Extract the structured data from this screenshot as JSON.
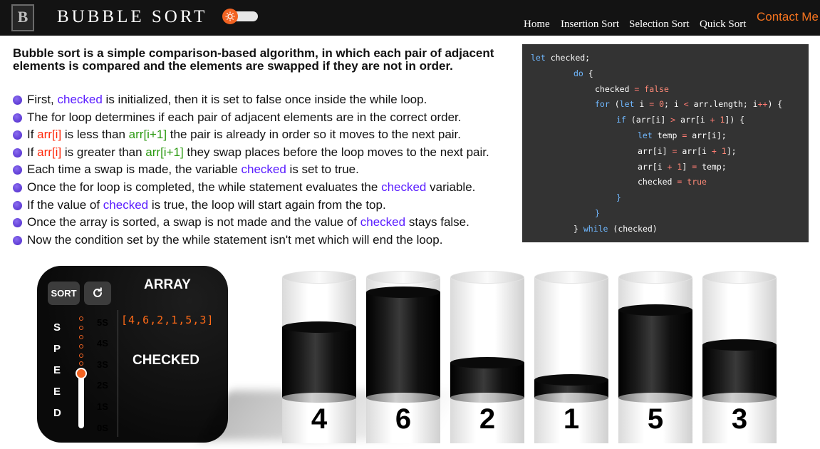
{
  "header": {
    "logo_letter": "B",
    "title": "BUBBLE SORT",
    "nav": [
      {
        "label": "Home"
      },
      {
        "label": "Insertion Sort"
      },
      {
        "label": "Selection Sort"
      },
      {
        "label": "Quick Sort"
      }
    ],
    "contact": "Contact Me",
    "toggle_icon": "sun-icon",
    "accent_color": "#f26322"
  },
  "intro": "Bubble sort is a simple comparison-based algorithm, in which each pair of adjacent elements is compared and the elements are swapped if they are not in order.",
  "bullets": [
    [
      {
        "t": "First, "
      },
      {
        "t": "checked",
        "c": "purple"
      },
      {
        "t": " is initialized, then it is set to false once inside the while loop."
      }
    ],
    [
      {
        "t": "The for loop determines if each pair of adjacent elements are in the correct order."
      }
    ],
    [
      {
        "t": "If "
      },
      {
        "t": "arr[i]",
        "c": "red"
      },
      {
        "t": " is less than "
      },
      {
        "t": "arr[i+1]",
        "c": "green"
      },
      {
        "t": " the pair is already in order so it moves to the next pair."
      }
    ],
    [
      {
        "t": "If "
      },
      {
        "t": "arr[i]",
        "c": "red"
      },
      {
        "t": " is greater than "
      },
      {
        "t": "arr[i+1]",
        "c": "green"
      },
      {
        "t": " they swap places before the loop moves to the next pair."
      }
    ],
    [
      {
        "t": "Each time a swap is made, the variable "
      },
      {
        "t": "checked",
        "c": "purple"
      },
      {
        "t": " is set to true."
      }
    ],
    [
      {
        "t": "Once the for loop is completed, the while statement evaluates the "
      },
      {
        "t": "checked",
        "c": "purple"
      },
      {
        "t": " variable."
      }
    ],
    [
      {
        "t": "If the value of "
      },
      {
        "t": "checked",
        "c": "purple"
      },
      {
        "t": " is true, the loop will start again from the top."
      }
    ],
    [
      {
        "t": "Once the array is sorted, a swap is not made and the value of "
      },
      {
        "t": "checked",
        "c": "purple"
      },
      {
        "t": " stays false."
      }
    ],
    [
      {
        "t": "Now the condition set by the while statement isn't met which will end the loop."
      }
    ]
  ],
  "code": [
    [
      {
        "t": "let",
        "c": "k"
      },
      {
        "t": " checked;"
      }
    ],
    [
      {
        "t": "do",
        "c": "k"
      },
      {
        "t": " {"
      }
    ],
    [
      {
        "t": "checked "
      },
      {
        "t": "=",
        "c": "o"
      },
      {
        "t": " "
      },
      {
        "t": "false",
        "c": "n"
      }
    ],
    [
      {
        "t": "for",
        "c": "k"
      },
      {
        "t": " ("
      },
      {
        "t": "let",
        "c": "k"
      },
      {
        "t": " i "
      },
      {
        "t": "=",
        "c": "o"
      },
      {
        "t": " "
      },
      {
        "t": "0",
        "c": "n"
      },
      {
        "t": "; i "
      },
      {
        "t": "<",
        "c": "o"
      },
      {
        "t": " arr.length; i"
      },
      {
        "t": "++",
        "c": "o"
      },
      {
        "t": ") {"
      }
    ],
    [
      {
        "t": "if",
        "c": "k"
      },
      {
        "t": " (arr[i] "
      },
      {
        "t": ">",
        "c": "o"
      },
      {
        "t": " arr[i "
      },
      {
        "t": "+",
        "c": "o"
      },
      {
        "t": " "
      },
      {
        "t": "1",
        "c": "n"
      },
      {
        "t": "]) {"
      }
    ],
    [
      {
        "t": "let",
        "c": "k"
      },
      {
        "t": " temp "
      },
      {
        "t": "=",
        "c": "o"
      },
      {
        "t": " arr[i];"
      }
    ],
    [
      {
        "t": "arr[i] "
      },
      {
        "t": "=",
        "c": "o"
      },
      {
        "t": " arr[i "
      },
      {
        "t": "+",
        "c": "o"
      },
      {
        "t": " "
      },
      {
        "t": "1",
        "c": "n"
      },
      {
        "t": "];"
      }
    ],
    [
      {
        "t": "arr[i "
      },
      {
        "t": "+",
        "c": "o"
      },
      {
        "t": " "
      },
      {
        "t": "1",
        "c": "n"
      },
      {
        "t": "] "
      },
      {
        "t": "=",
        "c": "o"
      },
      {
        "t": " temp;"
      }
    ],
    [
      {
        "t": "checked "
      },
      {
        "t": "=",
        "c": "o"
      },
      {
        "t": " "
      },
      {
        "t": "true",
        "c": "n"
      }
    ],
    [
      {
        "t": "}",
        "c": "k"
      }
    ],
    [
      {
        "t": "}",
        "c": "k"
      }
    ],
    [
      {
        "t": "} "
      },
      {
        "t": "while",
        "c": "k"
      },
      {
        "t": " (checked)"
      }
    ]
  ],
  "panel": {
    "sort_label": "SORT",
    "reset_icon": "refresh-icon",
    "speed_letters": [
      "S",
      "P",
      "E",
      "E",
      "D"
    ],
    "speed_levels": [
      "5S",
      "4S",
      "3S",
      "2S",
      "1S",
      "0S"
    ],
    "speed_selected": "2S",
    "array_title": "ARRAY",
    "array_value": "[4,6,2,1,5,3]",
    "status": "CHECKED"
  },
  "bars": [
    {
      "value": "4",
      "fill": 0.67
    },
    {
      "value": "6",
      "fill": 1.0
    },
    {
      "value": "2",
      "fill": 0.33
    },
    {
      "value": "1",
      "fill": 0.17
    },
    {
      "value": "5",
      "fill": 0.83
    },
    {
      "value": "3",
      "fill": 0.5
    }
  ]
}
